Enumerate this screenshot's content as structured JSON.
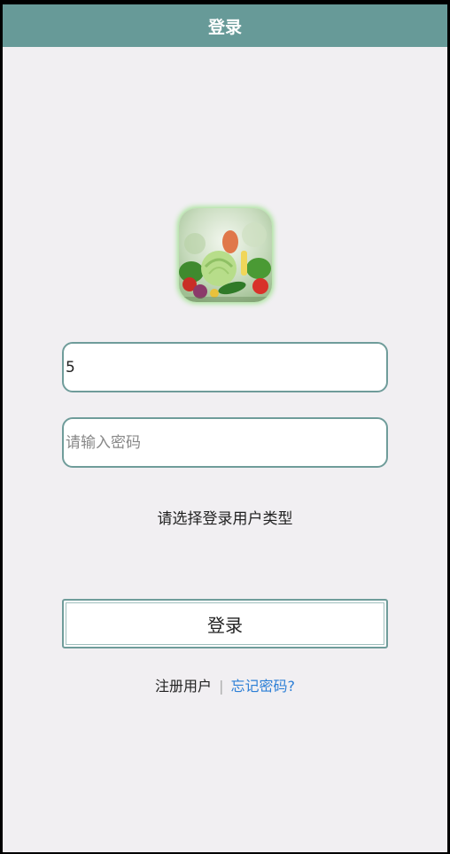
{
  "header": {
    "title": "登录"
  },
  "logo": {
    "icon": "vegetables-logo-icon"
  },
  "form": {
    "username_value": "5",
    "password_placeholder": "请输入密码",
    "role_prompt": "请选择登录用户类型",
    "login_label": "登录"
  },
  "links": {
    "register": "注册用户",
    "separator": "|",
    "forgot": "忘记密码?"
  },
  "colors": {
    "header": "#679a98",
    "background": "#f1eff2",
    "border": "#6f9c9a",
    "link": "#2d7fd6"
  }
}
